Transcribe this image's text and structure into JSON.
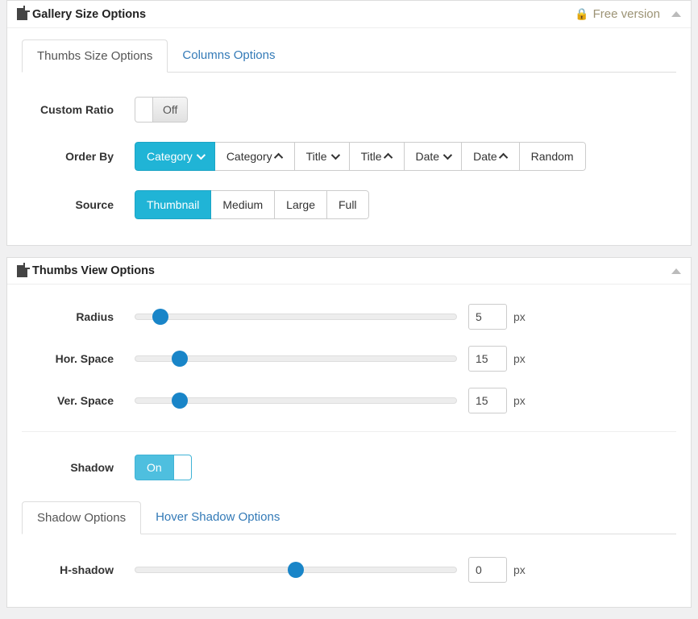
{
  "panel1": {
    "title": "Gallery Size Options",
    "free_version_label": "Free version",
    "tabs": {
      "thumbs_size": "Thumbs Size Options",
      "columns": "Columns Options"
    },
    "fields": {
      "custom_ratio": {
        "label": "Custom Ratio",
        "value": "Off"
      },
      "order_by": {
        "label": "Order By"
      },
      "source": {
        "label": "Source"
      }
    },
    "order_options": {
      "category_desc": "Category",
      "category_asc": "Category",
      "title_desc": "Title",
      "title_asc": "Title",
      "date_desc": "Date",
      "date_asc": "Date",
      "random": "Random"
    },
    "source_options": {
      "thumbnail": "Thumbnail",
      "medium": "Medium",
      "large": "Large",
      "full": "Full"
    }
  },
  "panel2": {
    "title": "Thumbs View Options",
    "fields": {
      "radius": {
        "label": "Radius",
        "value": "5",
        "unit": "px",
        "pct": 8
      },
      "hor_space": {
        "label": "Hor. Space",
        "value": "15",
        "unit": "px",
        "pct": 14
      },
      "ver_space": {
        "label": "Ver. Space",
        "value": "15",
        "unit": "px",
        "pct": 14
      },
      "shadow": {
        "label": "Shadow",
        "value": "On"
      },
      "h_shadow": {
        "label": "H-shadow",
        "value": "0",
        "unit": "px",
        "pct": 50
      }
    },
    "shadow_tabs": {
      "shadow": "Shadow Options",
      "hover_shadow": "Hover Shadow Options"
    }
  }
}
